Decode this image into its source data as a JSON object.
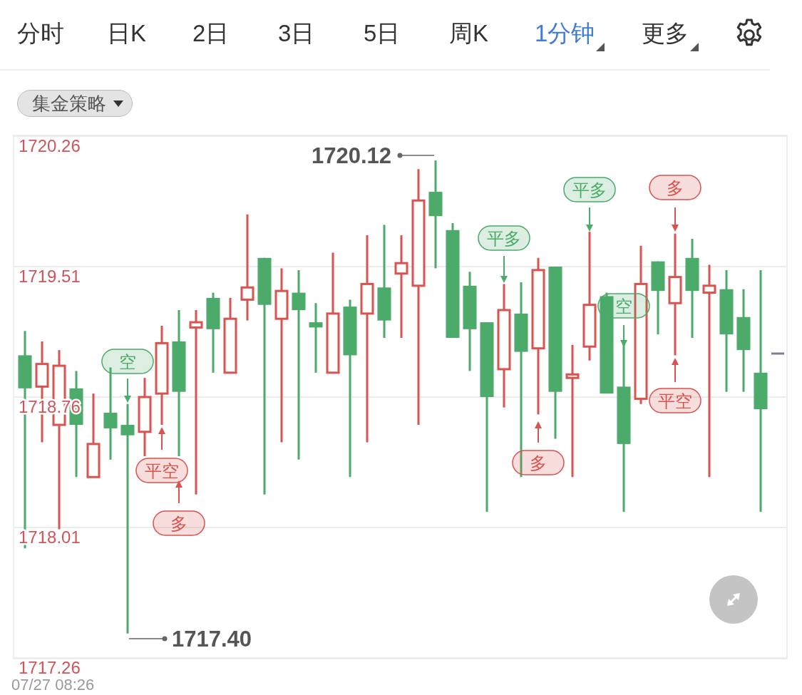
{
  "tabs": [
    {
      "label": "分时",
      "selected": false,
      "dropdown": false
    },
    {
      "label": "日K",
      "selected": false,
      "dropdown": false
    },
    {
      "label": "2日",
      "selected": false,
      "dropdown": false
    },
    {
      "label": "3日",
      "selected": false,
      "dropdown": false
    },
    {
      "label": "5日",
      "selected": false,
      "dropdown": false
    },
    {
      "label": "周K",
      "selected": false,
      "dropdown": false
    },
    {
      "label": "1分钟",
      "selected": true,
      "dropdown": true
    },
    {
      "label": "更多",
      "selected": false,
      "dropdown": true
    }
  ],
  "strategy_dropdown": {
    "label": "集金策略"
  },
  "chart": {
    "chart_data": {
      "type": "candlestick",
      "grid": true,
      "ylim": [
        1717.26,
        1720.26
      ],
      "yticks": [
        1720.26,
        1719.51,
        1718.76,
        1718.01,
        1717.26
      ],
      "ohlc": [
        [
          1719.0,
          1719.14,
          1717.89,
          1718.81
        ],
        [
          1718.82,
          1719.08,
          1718.5,
          1718.95
        ],
        [
          1718.6,
          1719.03,
          1718.0,
          1718.94
        ],
        [
          1718.81,
          1718.91,
          1718.3,
          1718.6
        ],
        [
          1718.3,
          1718.78,
          1718.3,
          1718.49
        ],
        [
          1718.67,
          1718.93,
          1718.4,
          1718.58
        ],
        [
          1718.6,
          1718.72,
          1717.4,
          1718.54
        ],
        [
          1718.56,
          1718.87,
          1718.42,
          1718.76
        ],
        [
          1718.78,
          1719.17,
          1718.6,
          1719.07
        ],
        [
          1719.08,
          1719.26,
          1718.42,
          1718.79
        ],
        [
          1719.16,
          1719.26,
          1718.2,
          1719.19
        ],
        [
          1719.33,
          1719.36,
          1718.9,
          1719.15
        ],
        [
          1718.9,
          1719.33,
          1718.9,
          1719.21
        ],
        [
          1719.32,
          1719.81,
          1719.2,
          1719.39
        ],
        [
          1719.56,
          1719.56,
          1718.2,
          1719.29
        ],
        [
          1719.21,
          1719.5,
          1718.5,
          1719.37
        ],
        [
          1719.36,
          1719.49,
          1718.4,
          1719.26
        ],
        [
          1719.19,
          1719.3,
          1718.9,
          1719.16
        ],
        [
          1718.9,
          1719.59,
          1718.9,
          1719.24
        ],
        [
          1719.28,
          1719.32,
          1718.3,
          1719.0
        ],
        [
          1719.24,
          1719.69,
          1718.5,
          1719.41
        ],
        [
          1719.39,
          1719.75,
          1719.1,
          1719.2
        ],
        [
          1719.47,
          1719.69,
          1719.1,
          1719.53
        ],
        [
          1719.4,
          1720.07,
          1718.6,
          1719.89
        ],
        [
          1719.94,
          1720.12,
          1719.5,
          1719.8
        ],
        [
          1719.72,
          1719.76,
          1719.1,
          1719.1
        ],
        [
          1719.4,
          1719.48,
          1718.91,
          1719.15
        ],
        [
          1719.19,
          1719.19,
          1718.1,
          1718.76
        ],
        [
          1718.92,
          1719.41,
          1718.7,
          1719.26
        ],
        [
          1719.24,
          1719.42,
          1718.3,
          1719.02
        ],
        [
          1719.04,
          1719.56,
          1718.66,
          1719.49
        ],
        [
          1719.51,
          1719.51,
          1718.52,
          1718.79
        ],
        [
          1718.87,
          1719.06,
          1718.3,
          1718.89
        ],
        [
          1719.05,
          1719.71,
          1718.97,
          1719.29
        ],
        [
          1719.34,
          1719.36,
          1718.78,
          1718.78
        ],
        [
          1718.82,
          1719.09,
          1718.1,
          1718.49
        ],
        [
          1718.75,
          1719.63,
          1718.72,
          1719.41
        ],
        [
          1719.54,
          1719.54,
          1719.12,
          1719.37
        ],
        [
          1719.3,
          1719.7,
          1719.0,
          1719.45
        ],
        [
          1719.56,
          1719.67,
          1719.1,
          1719.37
        ],
        [
          1719.36,
          1719.52,
          1718.3,
          1719.4
        ],
        [
          1719.38,
          1719.49,
          1718.79,
          1719.12
        ],
        [
          1719.22,
          1719.38,
          1718.79,
          1719.03
        ],
        [
          1718.9,
          1719.49,
          1718.1,
          1718.69
        ]
      ]
    },
    "signals": [
      {
        "text": "空",
        "color": "#4caa6a"
      },
      {
        "text": "平空",
        "color": "#d9534f"
      },
      {
        "text": "多",
        "color": "#d9534f"
      },
      {
        "text": "平多",
        "color": "#4caa6a"
      },
      {
        "text": "多",
        "color": "#d9534f"
      },
      {
        "text": "平多",
        "color": "#4caa6a"
      },
      {
        "text": "空",
        "color": "#4caa6a"
      },
      {
        "text": "多",
        "color": "#d9534f"
      },
      {
        "text": "平空",
        "color": "#d9534f"
      }
    ],
    "price_labels": [
      "1720.12",
      "1717.40"
    ]
  },
  "timestamp": "07/27 08:26"
}
